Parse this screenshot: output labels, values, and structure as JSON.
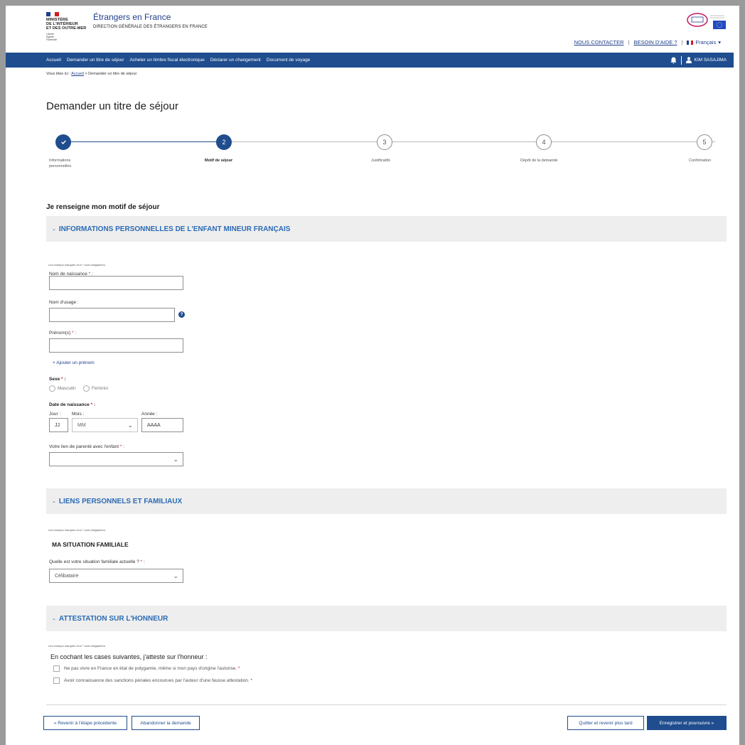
{
  "header": {
    "gov_lines": [
      "MINISTÈRE",
      "DE L'INTÉRIEUR",
      "ET DES OUTRE-MER"
    ],
    "gov_motto": [
      "Liberté",
      "Égalité",
      "Fraternité"
    ],
    "site_title": "Étrangers en France",
    "site_subtitle": "DIRECTION GÉNÉRALE DES ÉTRANGERS EN FRANCE",
    "links": {
      "contact": "NOUS CONTACTER",
      "help": "BESOIN D'AIDE ?",
      "sep": "|",
      "language": "Français"
    },
    "colors": {
      "brand_blue": "#1f4d8e",
      "link_blue": "#1f3e8c",
      "accent_blue": "#2a6ab4",
      "required_red": "#d21c1c"
    }
  },
  "nav": {
    "items": [
      "Accueil",
      "Demander un titre de séjour",
      "Acheter un timbre fiscal électronique",
      "Déclarer un changement",
      "Document de voyage"
    ],
    "user": "KIM SASAJIMA",
    "bell_icon": "bell-icon",
    "user_icon": "user-icon"
  },
  "breadcrumb": {
    "prefix": "Vous êtes ici :",
    "home": "Accueil",
    "current": "> Demander un titre de séjour"
  },
  "page_title": "Demander un titre de séjour",
  "stepper": {
    "current_step": 2,
    "steps": [
      {
        "number": "1",
        "label_line1": "Informations",
        "label_line2": "personnelles",
        "state": "done"
      },
      {
        "number": "2",
        "label_line1": "Motif de séjour",
        "label_line2": "",
        "state": "active"
      },
      {
        "number": "3",
        "label_line1": "Justificatifs",
        "label_line2": "",
        "state": "todo"
      },
      {
        "number": "4",
        "label_line1": "Dépôt de la demande",
        "label_line2": "",
        "state": "todo"
      },
      {
        "number": "5",
        "label_line1": "Confirmation",
        "label_line2": "",
        "state": "todo"
      }
    ]
  },
  "form": {
    "intro": "Je renseigne mon motif de séjour",
    "required_note": "Les champs marqués d'un",
    "required_note_end": "sont obligatoires.",
    "required_star": "*",
    "section1": {
      "title": "INFORMATIONS PERSONNELLES DE L'ENFANT MINEUR FRANÇAIS",
      "birth_name_label": "Nom de naissance",
      "usage_name_label": "Nom d'usage :",
      "firstname_label": "Prénom(s)",
      "add_firstname": "+ Ajouter un prénom",
      "sex_label": "Sexe",
      "sex_options": [
        "Masculin",
        "Féminin"
      ],
      "birthdate_label": "Date de naissance",
      "day_label": "Jour :",
      "month_label": "Mois :",
      "year_label": "Année :",
      "day_placeholder": "JJ",
      "month_placeholder": "MM",
      "year_placeholder": "AAAA",
      "relation_label": "Votre lien de parenté avec l'enfant",
      "relation_value": ""
    },
    "section2": {
      "title": "LIENS PERSONNELS ET FAMILIAUX",
      "subheading": "MA SITUATION FAMILIALE",
      "question": "Quelle est votre situation familiale actuelle ?",
      "value": "Célibataire"
    },
    "section3": {
      "title": "ATTESTATION SUR L'HONNEUR",
      "lead": "En cochant les cases suivantes, j'atteste sur l'honneur :",
      "checkboxes": [
        "Ne pas vivre en France en état de polygamie, même si mon pays d'origine l'autorise.",
        "Avoir connaissance des sanctions pénales encourues par l'auteur d'une fausse attestation."
      ]
    }
  },
  "buttons": {
    "back": "« Revenir à l'étape précédente",
    "abandon": "Abandonner la demande",
    "later": "Quitter et revenir plus tard",
    "continue": "Enregistrer et poursuivre »"
  }
}
